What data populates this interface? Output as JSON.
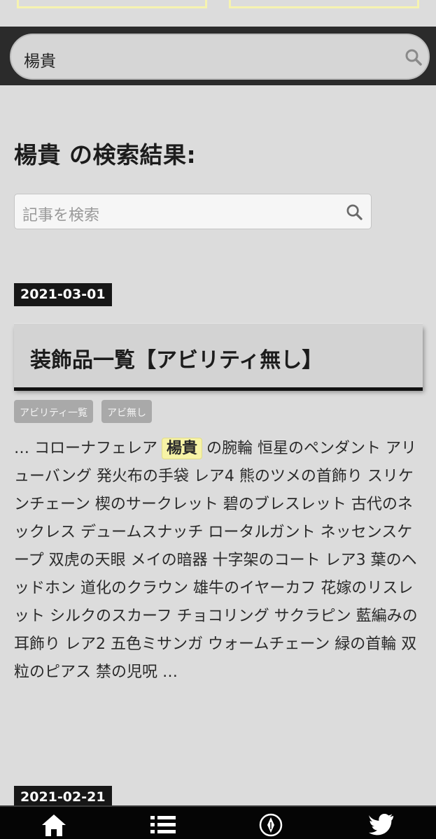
{
  "header": {
    "search_value": "楊貴"
  },
  "page": {
    "title": "楊貴 の検索結果:",
    "article_search_placeholder": "記事を検索"
  },
  "posts": [
    {
      "date": "2021-03-01",
      "title": "装飾品一覧【アビリティ無し】",
      "tags": [
        "アビリティ一覧",
        "アビ無し"
      ],
      "excerpt_before": "… コローナフェレア",
      "excerpt_highlight": "楊貴",
      "excerpt_after": "の腕輪 恒星のペンダント アリューバング 発火布の手袋 レア4 熊のツメの首飾り スリケンチェーン 楔のサークレット 碧のブレスレット 古代のネックレス デュームスナッチ ロータルガント ネッセンスケープ 双虎の天眼 メイの暗器 十字架のコート レア3 葉のヘッドホン 道化のクラウン 雄牛のイヤーカフ 花嫁のリスレット シルクのスカーフ チョコリング サクラピン 藍編みの耳飾り レア2 五色ミサンガ ウォームチェーン 緑の首輪 双粒のピアス 禁の児呪 …"
    },
    {
      "date": "2021-02-21"
    }
  ],
  "icons": {
    "header_search": "search-icon",
    "article_search": "search-icon",
    "nav": [
      "home-icon",
      "list-icon",
      "pen-nib-icon",
      "twitter-bird-icon"
    ]
  }
}
